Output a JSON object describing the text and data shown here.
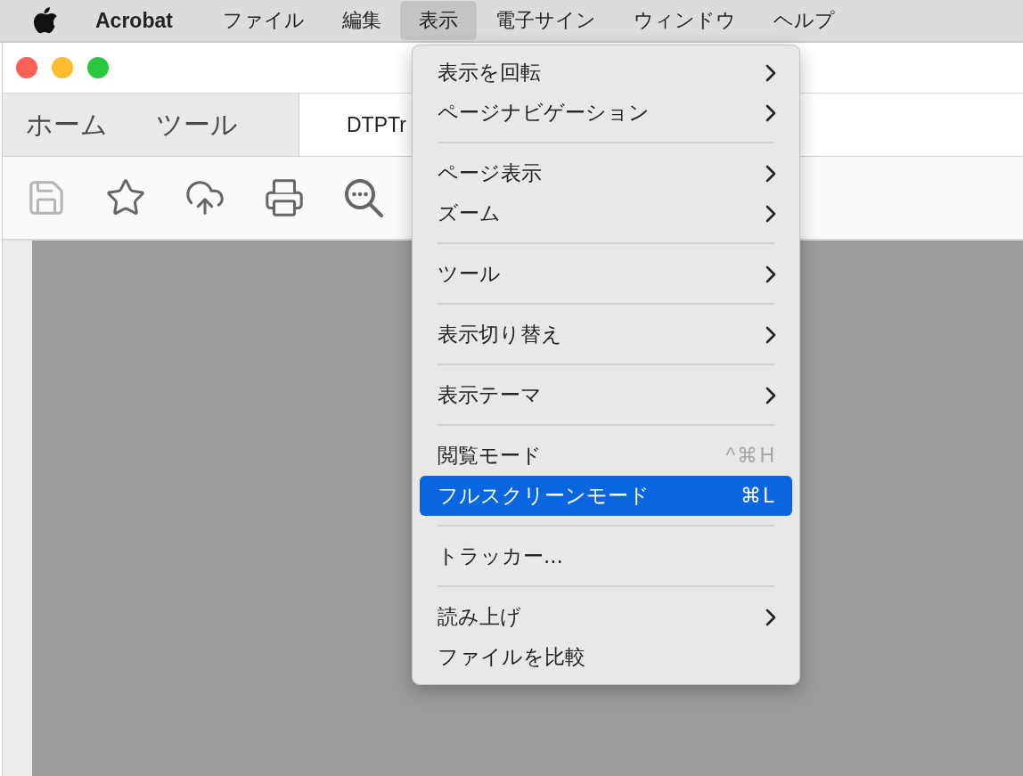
{
  "menubar": {
    "items": [
      {
        "label": "Acrobat",
        "kind": "app",
        "selected": false
      },
      {
        "label": "ファイル",
        "kind": "menu",
        "selected": false
      },
      {
        "label": "編集",
        "kind": "menu",
        "selected": false
      },
      {
        "label": "表示",
        "kind": "menu",
        "selected": true
      },
      {
        "label": "電子サイン",
        "kind": "menu",
        "selected": false
      },
      {
        "label": "ウィンドウ",
        "kind": "menu",
        "selected": false
      },
      {
        "label": "ヘルプ",
        "kind": "menu",
        "selected": false
      }
    ]
  },
  "window": {
    "tabs": [
      {
        "label": "ホーム",
        "selected": false
      },
      {
        "label": "ツール",
        "selected": false
      },
      {
        "label": "DTPTr",
        "selected": true
      }
    ],
    "toolbar": [
      {
        "kind": "save",
        "disabled": true
      },
      {
        "kind": "star",
        "disabled": false
      },
      {
        "kind": "upload",
        "disabled": false
      },
      {
        "kind": "print",
        "disabled": false
      },
      {
        "kind": "search",
        "disabled": false
      }
    ]
  },
  "menu": {
    "groups": [
      [
        {
          "label": "表示を回転",
          "submenu": true,
          "selected": false
        },
        {
          "label": "ページナビゲーション",
          "submenu": true,
          "selected": false
        }
      ],
      [
        {
          "label": "ページ表示",
          "submenu": true,
          "selected": false
        },
        {
          "label": "ズーム",
          "submenu": true,
          "selected": false
        }
      ],
      [
        {
          "label": "ツール",
          "submenu": true,
          "selected": false
        }
      ],
      [
        {
          "label": "表示切り替え",
          "submenu": true,
          "selected": false
        }
      ],
      [
        {
          "label": "表示テーマ",
          "submenu": true,
          "selected": false
        }
      ],
      [
        {
          "label": "閲覧モード",
          "submenu": false,
          "selected": false,
          "shortcut": "^⌘H"
        },
        {
          "label": "フルスクリーンモード",
          "submenu": false,
          "selected": true,
          "shortcut": "⌘L"
        }
      ],
      [
        {
          "label": "トラッカー...",
          "submenu": false,
          "selected": false
        }
      ],
      [
        {
          "label": "読み上げ",
          "submenu": true,
          "selected": false
        },
        {
          "label": "ファイルを比較",
          "submenu": false,
          "selected": false
        }
      ]
    ]
  }
}
